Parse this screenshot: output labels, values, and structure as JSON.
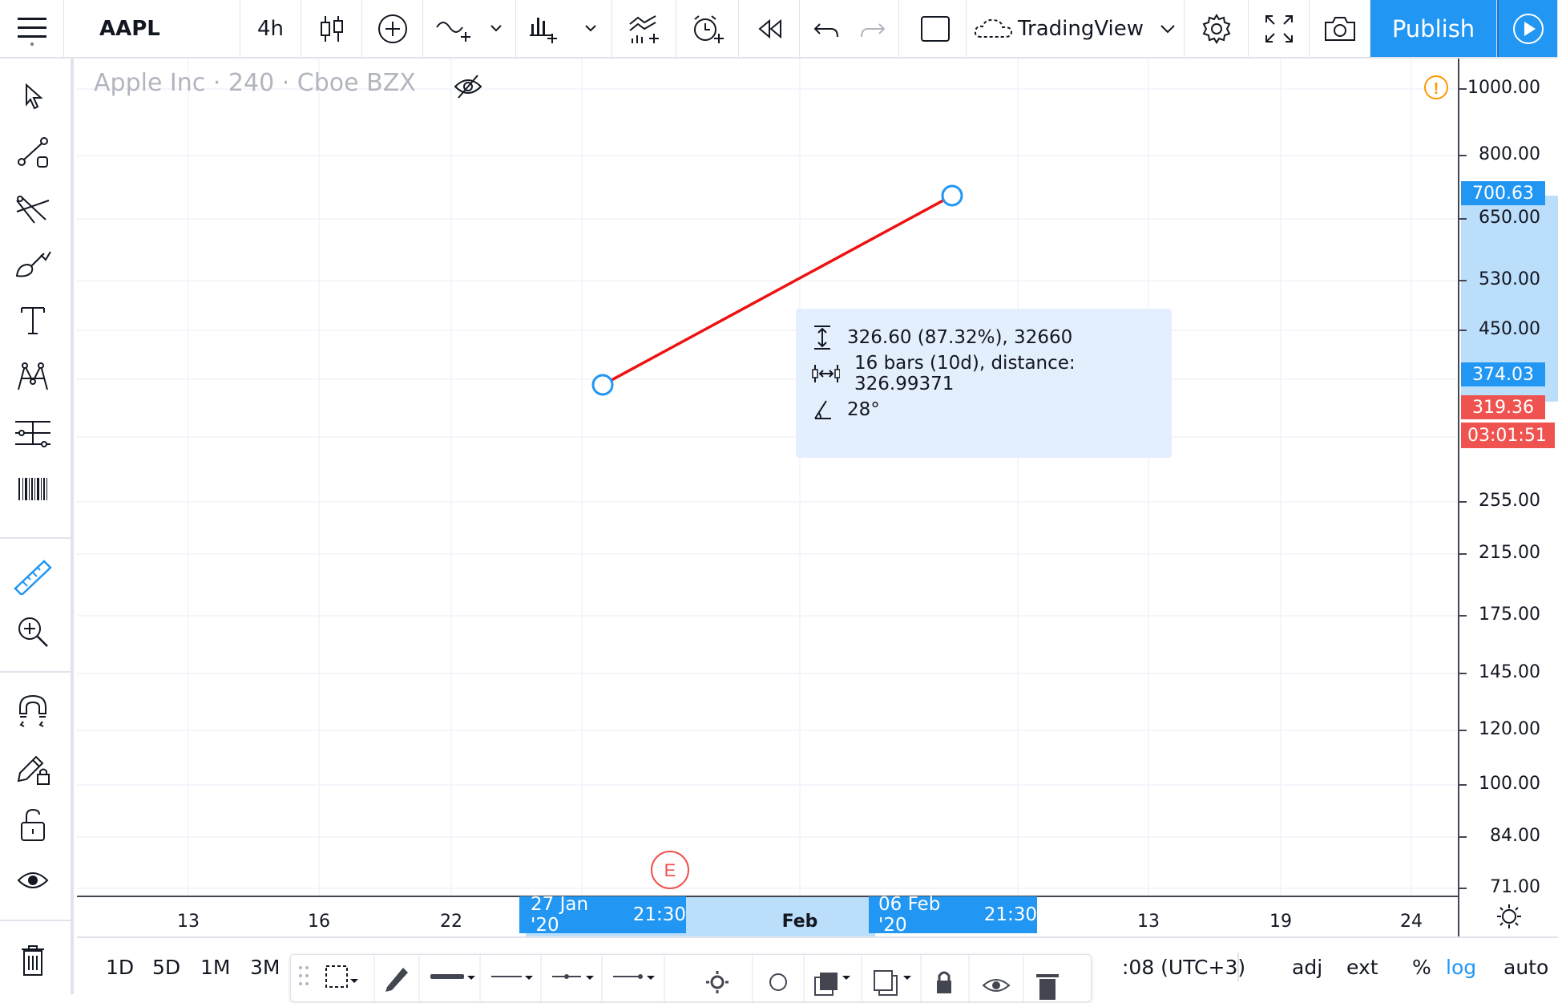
{
  "toolbar": {
    "symbol": "AAPL",
    "interval": "4h",
    "layout_name": "TradingView",
    "publish_label": "Publish"
  },
  "chart": {
    "legend": "Apple Inc · 240 · Cboe BZX",
    "price_labels": [
      "1000.00",
      "800.00",
      "650.00",
      "530.00",
      "450.00",
      "255.00",
      "215.00",
      "175.00",
      "145.00",
      "120.00",
      "100.00",
      "84.00",
      "71.00"
    ],
    "time_labels": [
      "13",
      "16",
      "22",
      "Feb",
      "13",
      "19",
      "24"
    ],
    "earnings_marker": "E"
  },
  "measure": {
    "price_line": "326.60 (87.32%), 32660",
    "bars_line": "16 bars (10d), distance: 326.99371",
    "angle_line": "28°",
    "start_time": "27 Jan '20",
    "start_clock": "21:30",
    "end_time": "06 Feb '20",
    "end_clock": "21:30",
    "end_price": "700.63",
    "start_price": "374.03"
  },
  "last_price": {
    "value": "319.36",
    "countdown": "03:01:51",
    "color": "#ef5350"
  },
  "accent": "#2196f3",
  "line_color": "#ee1111",
  "bottombar": {
    "ranges": [
      "1D",
      "5D",
      "1M",
      "3M"
    ],
    "timezone": ":08 (UTC+3)",
    "adj": "adj",
    "ext": "ext",
    "percent": "%",
    "log": "log",
    "auto": "auto"
  }
}
